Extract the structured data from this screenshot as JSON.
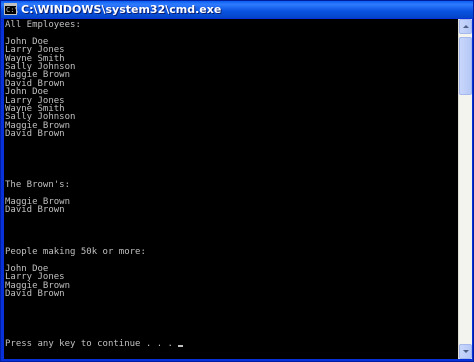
{
  "window": {
    "title": "C:\\WINDOWS\\system32\\cmd.exe",
    "icon": "cmd-icon",
    "colors": {
      "titlebar": "#0852e0",
      "console_bg": "#000000",
      "console_fg": "#c0c0c0"
    }
  },
  "console": {
    "lines": [
      "All Employees:",
      "",
      "John Doe",
      "Larry Jones",
      "Wayne Smith",
      "Sally Johnson",
      "Maggie Brown",
      "David Brown",
      "John Doe",
      "Larry Jones",
      "Wayne Smith",
      "Sally Johnson",
      "Maggie Brown",
      "David Brown",
      "",
      "",
      "",
      "",
      "",
      "The Brown's:",
      "",
      "Maggie Brown",
      "David Brown",
      "",
      "",
      "",
      "",
      "People making 50k or more:",
      "",
      "John Doe",
      "Larry Jones",
      "Maggie Brown",
      "David Brown",
      "",
      "",
      "",
      "",
      "",
      "Press any key to continue . . . "
    ]
  }
}
